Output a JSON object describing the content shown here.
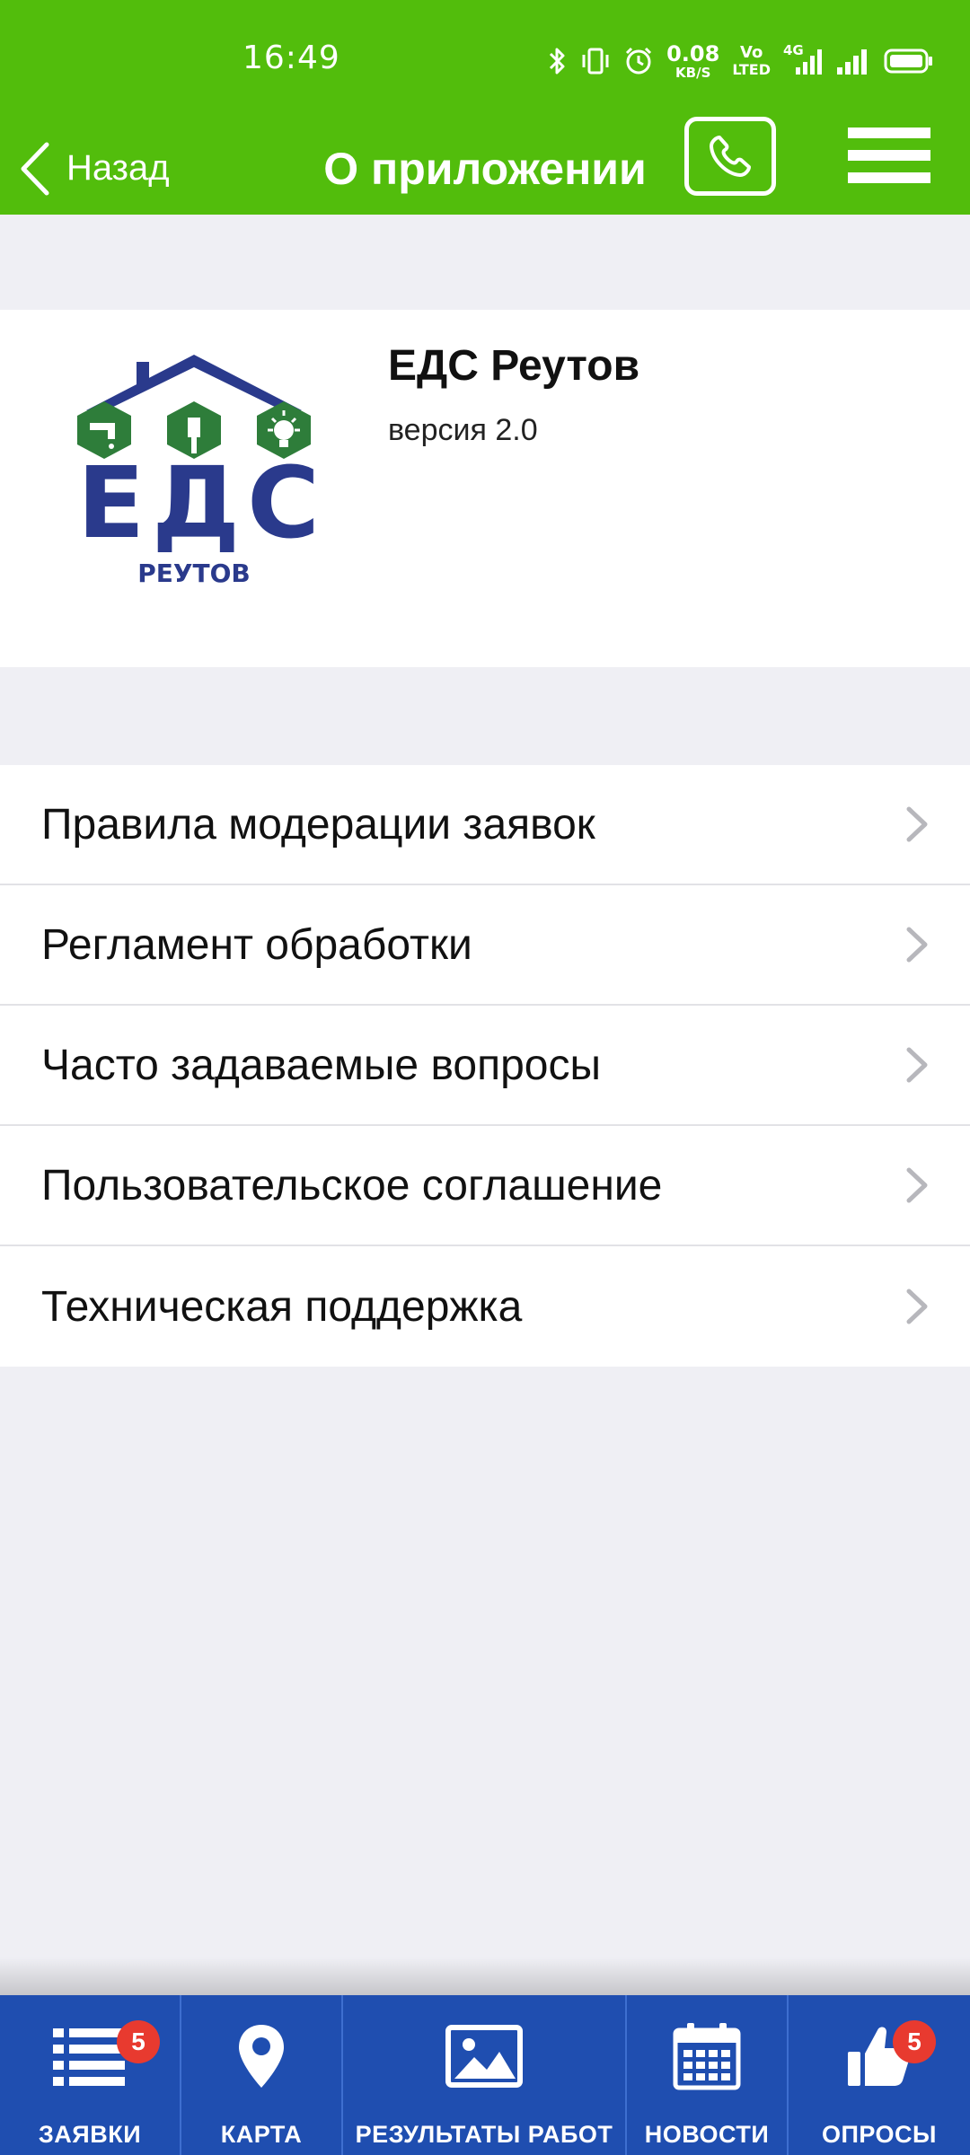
{
  "status_bar": {
    "time": "16:49",
    "net_speed_value": "0.08",
    "net_speed_unit": "KB/S",
    "volte_line1": "Vo",
    "volte_line2": "LTED",
    "network_type": "4G",
    "icons": [
      "bluetooth-icon",
      "vibrate-icon",
      "alarm-icon",
      "signal-icon",
      "battery-icon"
    ]
  },
  "header": {
    "back_label": "Назад",
    "title": "О приложении",
    "background_color": "#52bd0c"
  },
  "app_info": {
    "name": "ЕДС Реутов",
    "version": "версия 2.0",
    "logo_text": "ЕДС",
    "logo_subtext": "РЕУТОВ"
  },
  "menu": {
    "items": [
      {
        "label": "Правила модерации заявок"
      },
      {
        "label": "Регламент обработки"
      },
      {
        "label": "Часто задаваемые вопросы"
      },
      {
        "label": "Пользовательское соглашение"
      },
      {
        "label": "Техническая поддержка"
      }
    ]
  },
  "tabbar": {
    "background_color": "#1f4eb0",
    "badge_color": "#e83a2f",
    "tabs": [
      {
        "label": "ЗАЯВКИ",
        "icon": "list-icon",
        "badge": "5"
      },
      {
        "label": "КАРТА",
        "icon": "map-pin-icon",
        "badge": ""
      },
      {
        "label": "РЕЗУЛЬТАТЫ РАБОТ",
        "icon": "image-icon",
        "badge": ""
      },
      {
        "label": "НОВОСТИ",
        "icon": "calendar-icon",
        "badge": ""
      },
      {
        "label": "ОПРОСЫ",
        "icon": "thumbs-up-icon",
        "badge": "5"
      }
    ]
  }
}
